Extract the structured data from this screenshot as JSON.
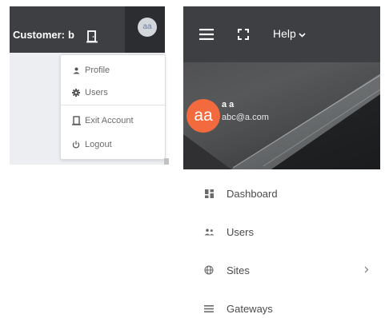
{
  "left": {
    "customer_label": "Customer:",
    "customer_value": "b",
    "avatar_initials": "aa",
    "dropdown": {
      "profile": "Profile",
      "users": "Users",
      "exit_account": "Exit Account",
      "logout": "Logout"
    }
  },
  "right": {
    "help_label": "Help",
    "profile": {
      "initials": "aa",
      "name": "a a",
      "email": "abc@a.com"
    },
    "nav": {
      "dashboard": "Dashboard",
      "users": "Users",
      "sites": "Sites",
      "gateways": "Gateways"
    }
  },
  "colors": {
    "topbar": "#3d3f42",
    "avatar_accent": "#f26a3d",
    "menu_text": "#4b4b4b"
  },
  "icons": [
    "door-icon",
    "person-icon",
    "gear-icon",
    "power-icon",
    "hamburger-menu-icon",
    "fullscreen-icon",
    "chevron-down-icon",
    "dashboard-icon",
    "users-icon",
    "globe-icon",
    "chevron-right-icon",
    "list-icon"
  ]
}
